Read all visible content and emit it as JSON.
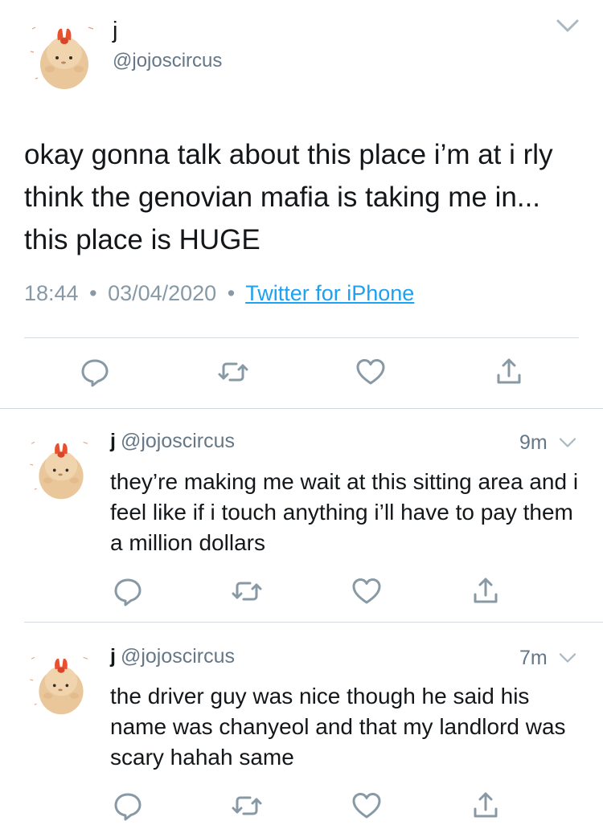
{
  "main_tweet": {
    "display_name": "j",
    "handle": "@jojoscircus",
    "text": "okay gonna talk about this place i’m at i rly think the genovian mafia is taking me in... this place is HUGE",
    "time": "18:44",
    "date": "03/04/2020",
    "separator": "•",
    "source": "Twitter for iPhone"
  },
  "replies": [
    {
      "display_name": "j",
      "handle": "@jojoscircus",
      "time_ago": "9m",
      "text": "they’re making me wait at this sitting area and i feel like if i touch anything i’ll have to pay them a million dollars"
    },
    {
      "display_name": "j",
      "handle": "@jojoscircus",
      "time_ago": "7m",
      "text": "the driver guy was nice though he said his name was chanyeol and that my landlord was scary hahah same"
    }
  ],
  "icons": {
    "reply": "reply-icon",
    "retweet": "retweet-icon",
    "like": "heart-icon",
    "share": "share-icon",
    "menu": "chevron-down-icon"
  },
  "colors": {
    "text": "#14171a",
    "secondary": "#657786",
    "meta": "#8899a6",
    "link": "#1da1f2",
    "icon": "#8899a6",
    "divider": "#ccd6dd"
  }
}
